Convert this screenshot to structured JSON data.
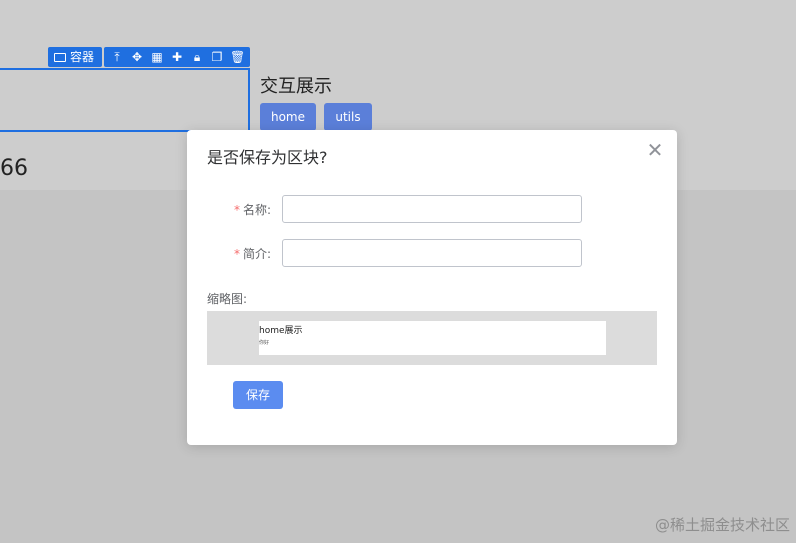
{
  "canvas": {
    "toolbar_label": "容器",
    "toolbar_icons": [
      "arrow-top-icon",
      "move-icon",
      "grid-icon",
      "plus-icon",
      "lock-icon",
      "copy-icon",
      "delete-icon"
    ],
    "title": "交互展示",
    "buttons": [
      "home",
      "utils"
    ],
    "number": "66"
  },
  "dialog": {
    "title": "是否保存为区块?",
    "name_label": "名称:",
    "name_value": "",
    "desc_label": "简介:",
    "desc_value": "",
    "thumb_label": "缩略图:",
    "thumb_title": "home展示",
    "thumb_sub": "你好",
    "save_label": "保存"
  },
  "watermark": "@稀土掘金技术社区",
  "colors": {
    "accent": "#1f6fe0",
    "button": "#5b8cf0",
    "required": "#f56c6c"
  }
}
